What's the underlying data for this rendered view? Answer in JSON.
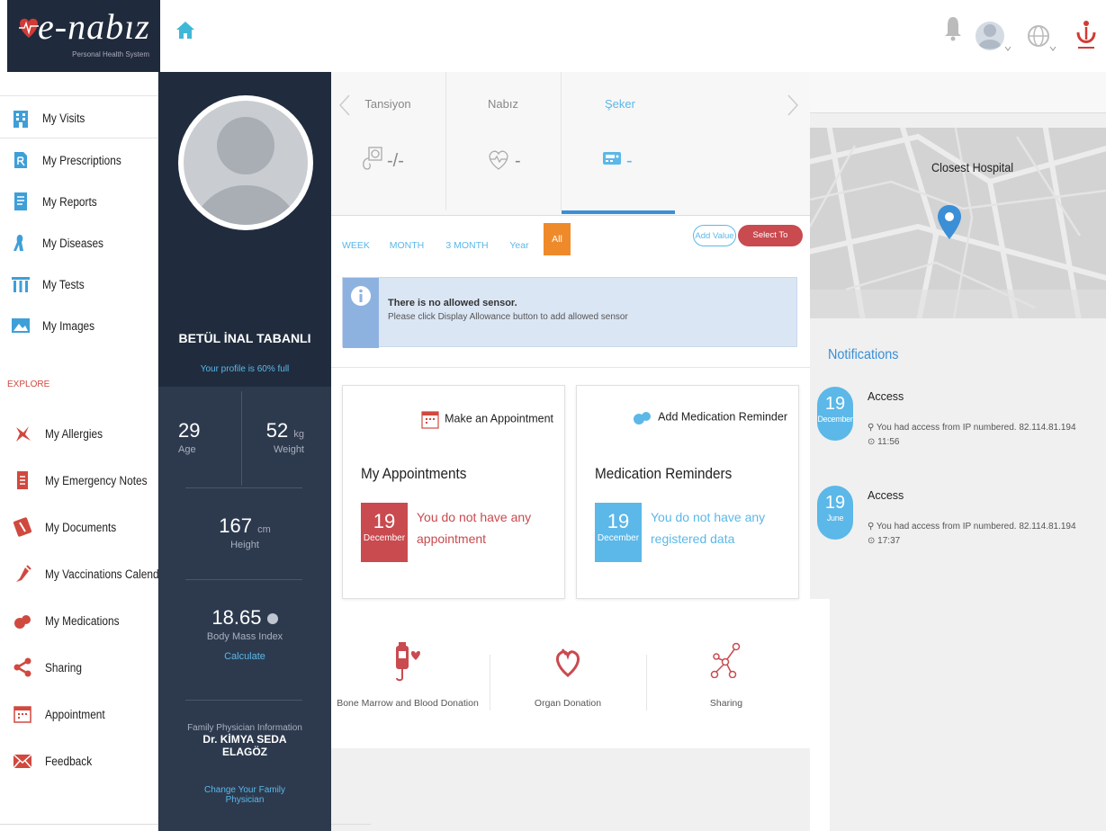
{
  "app": {
    "logo_text": "e-nabız",
    "logo_sub": "Personal Health System"
  },
  "sidebar": {
    "items": [
      {
        "label": "My Visits",
        "icon": "building-icon"
      },
      {
        "label": "My Prescriptions",
        "icon": "prescription-icon"
      },
      {
        "label": "My Reports",
        "icon": "report-icon"
      },
      {
        "label": "My Diseases",
        "icon": "body-icon"
      },
      {
        "label": "My Tests",
        "icon": "test-tubes-icon"
      },
      {
        "label": "My Images",
        "icon": "image-icon"
      }
    ],
    "explore_label": "EXPLORE",
    "explore_items": [
      {
        "label": "My Allergies",
        "icon": "allergy-icon"
      },
      {
        "label": "My Emergency Notes",
        "icon": "emergency-notes-icon"
      },
      {
        "label": "My Documents",
        "icon": "documents-icon"
      },
      {
        "label": "My Vaccinations Calendar",
        "icon": "vaccine-icon"
      },
      {
        "label": "My Medications",
        "icon": "pills-icon"
      },
      {
        "label": "Sharing",
        "icon": "share-icon"
      },
      {
        "label": "Appointment",
        "icon": "calendar-icon"
      },
      {
        "label": "Feedback",
        "icon": "mail-icon"
      }
    ]
  },
  "profile": {
    "name": "BETÜL İNAL TABANLI",
    "completeness": "Your profile is 60% full",
    "age": {
      "value": "29",
      "label": "Age"
    },
    "weight": {
      "value": "52",
      "unit": "kg",
      "label": "Weight"
    },
    "height": {
      "value": "167",
      "unit": "cm",
      "label": "Height"
    },
    "bmi": {
      "value": "18.65",
      "label": "Body Mass Index",
      "action": "Calculate"
    },
    "physician": {
      "label": "Family Physician Information",
      "name": "Dr. KİMYA SEDA ELAGÖZ",
      "change": "Change Your Family Physician"
    }
  },
  "vitals": {
    "tabs": [
      {
        "label": "Tansiyon",
        "value": "-/-",
        "icon": "blood-pressure-icon"
      },
      {
        "label": "Nabız",
        "value": "-",
        "icon": "heart-pulse-icon"
      },
      {
        "label": "Şeker",
        "value": "-",
        "icon": "glucose-meter-icon",
        "active": true
      }
    ],
    "periods": [
      "WEEK",
      "MONTH",
      "3 MONTH",
      "Year",
      "All"
    ],
    "active_period": "All",
    "add_value": "Add Value",
    "select_display": "Select To Display",
    "info_title": "There is no allowed sensor.",
    "info_body": "Please click Display Allowance button to add allowed sensor"
  },
  "appointments": {
    "action": "Make an Appointment",
    "title": "My Appointments",
    "day": "19",
    "month": "December",
    "message": "You do not have any appointment"
  },
  "medications": {
    "action": "Add Medication Reminder",
    "title": "Medication Reminders",
    "day": "19",
    "month": "December",
    "message": "You do not have any registered data"
  },
  "bottom_actions": [
    {
      "label": "Bone Marrow and Blood Donation",
      "icon": "blood-bag-icon"
    },
    {
      "label": "Organ Donation",
      "icon": "organ-heart-icon"
    },
    {
      "label": "Sharing",
      "icon": "network-share-icon"
    }
  ],
  "map": {
    "title": "Closest Hospital"
  },
  "notifications": {
    "title": "Notifications",
    "items": [
      {
        "day": "19",
        "month": "December",
        "head": "Access",
        "body": "You had access from IP numbered. 82.114.81.194",
        "time": "11:56"
      },
      {
        "day": "19",
        "month": "June",
        "head": "Access",
        "body": "You had access from IP numbered. 82.114.81.194",
        "time": "17:37"
      }
    ]
  },
  "colors": {
    "navy": "#202c3e",
    "accent_blue": "#5bb8e8",
    "red": "#d0493f",
    "orange": "#ef8a2b"
  }
}
